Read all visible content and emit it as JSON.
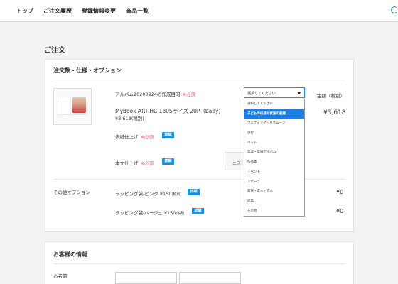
{
  "nav": {
    "items": [
      "トップ",
      "ご注文履歴",
      "登録情報変更",
      "商品一覧"
    ]
  },
  "page": {
    "title": "ご注文"
  },
  "order_card": {
    "heading": "注文数・仕様・オプション",
    "price_header": "金額（税別）",
    "purpose_label": "アルバム20200924の作成目的",
    "required": "※必須",
    "product_name": "MyBook ART-HC 180Sサイズ 20P（baby)",
    "product_price": "¥3,618(税別)",
    "line_total": "¥3,618",
    "cover_label": "表紙仕上げ",
    "body_label": "本文仕上げ",
    "detail_badge": "詳細",
    "ghost_text": "ニス",
    "other_options_label": "その他オプション",
    "wrap_pink": "ラッピング袋-ピンク ¥150",
    "wrap_beige": "ラッピング袋-ベージュ ¥150",
    "tax_note": "(税別)",
    "wrap_pink_price": "¥0",
    "wrap_beige_price": "¥0"
  },
  "select": {
    "current": "選択してください",
    "options": [
      "選択してください",
      "子どもの成長や家族の記録",
      "ウェディング・ハネムーン",
      "旅行",
      "ペット",
      "卒業・卒園アルバム",
      "作品集",
      "イベント",
      "スポーツ",
      "家族・友人・恋人",
      "建築",
      "その他"
    ],
    "highlighted_index": 1
  },
  "customer_card": {
    "heading": "お客様の情報",
    "name_label": "お名前"
  },
  "colors": {
    "accent": "#1a8fd6",
    "required": "#e24a6a",
    "highlight": "#1e7ee6"
  }
}
